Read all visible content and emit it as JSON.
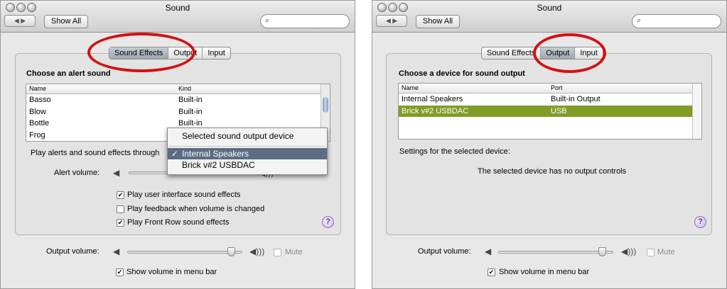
{
  "left": {
    "title": "Sound",
    "nav_arrows": "◀ ▶",
    "show_all": "Show All",
    "search_icon": "magnifier-icon",
    "tabs": [
      {
        "label": "Sound Effects",
        "selected": true
      },
      {
        "label": "Output",
        "selected": false
      },
      {
        "label": "Input",
        "selected": false
      }
    ],
    "heading": "Choose an alert sound",
    "list": {
      "columns": [
        "Name",
        "Kind"
      ],
      "rows": [
        {
          "name": "Basso",
          "kind": "Built-in"
        },
        {
          "name": "Blow",
          "kind": "Built-in"
        },
        {
          "name": "Bottle",
          "kind": "Built-in"
        },
        {
          "name": "Frog",
          "kind": ""
        }
      ]
    },
    "play_through_label": "Play alerts and sound effects through",
    "popup": {
      "title": "Selected sound output device",
      "items": [
        {
          "label": "Internal Speakers",
          "checked": true,
          "check_mark": "✓"
        },
        {
          "label": "Brick v#2 USBDAC",
          "checked": false
        }
      ]
    },
    "alert_volume_label": "Alert volume:",
    "checkboxes": [
      {
        "label": "Play user interface sound effects",
        "checked": true
      },
      {
        "label": "Play feedback when volume is changed",
        "checked": false
      },
      {
        "label": "Play Front Row sound effects",
        "checked": true
      }
    ],
    "help": "?",
    "output_volume_label": "Output volume:",
    "output_volume": 0.9,
    "mute_label": "Mute",
    "menu_bar_label": "Show volume in menu bar",
    "check_glyph": "✔",
    "speaker_low": "◀",
    "speaker_high": "◀)))"
  },
  "right": {
    "title": "Sound",
    "nav_arrows": "◀ ▶",
    "show_all": "Show All",
    "search_icon": "magnifier-icon",
    "tabs": [
      {
        "label": "Sound Effects",
        "selected": false
      },
      {
        "label": "Output",
        "selected": true
      },
      {
        "label": "Input",
        "selected": false
      }
    ],
    "heading": "Choose a device for sound output",
    "list": {
      "columns": [
        "Name",
        "Port"
      ],
      "rows": [
        {
          "name": "Internal Speakers",
          "port": "Built-in Output",
          "selected": false
        },
        {
          "name": "Brick v#2 USBDAC",
          "port": "USB",
          "selected": true
        }
      ]
    },
    "settings_label": "Settings for the selected device:",
    "no_controls": "The selected device has no output controls",
    "help": "?",
    "output_volume_label": "Output volume:",
    "output_volume": 0.9,
    "mute_label": "Mute",
    "menu_bar_label": "Show volume in menu bar",
    "check_glyph": "✔",
    "speaker_low": "◀",
    "speaker_high": "◀)))"
  },
  "colors": {
    "annotation_ring": "#d31111",
    "selected_row": "#7f9d27",
    "menu_highlight": "#5c6c83"
  }
}
